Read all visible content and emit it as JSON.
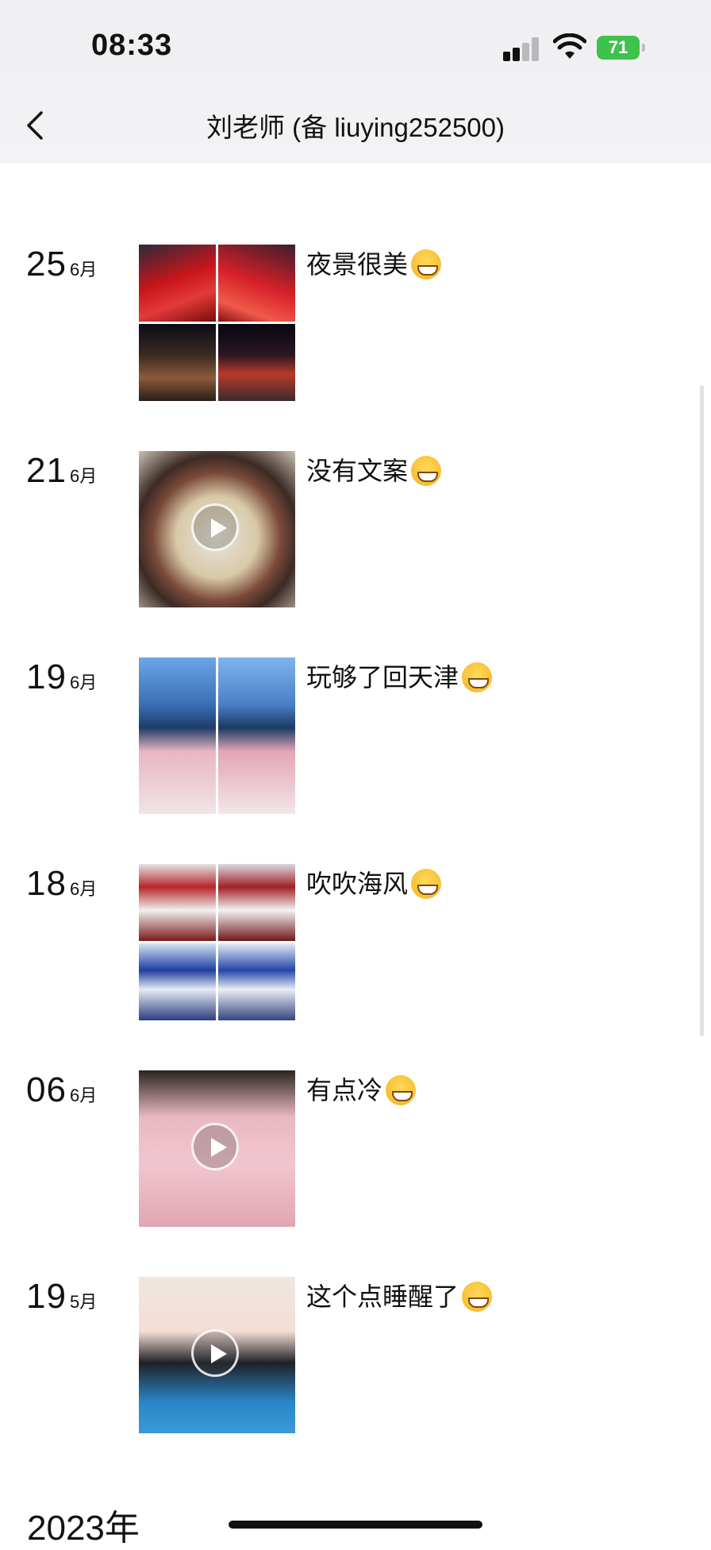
{
  "status_bar": {
    "time": "08:33",
    "battery": "71"
  },
  "nav": {
    "title": "刘老师 (备 liuying252500)"
  },
  "posts": [
    {
      "day": "25",
      "month": "6月",
      "caption": "夜景很美",
      "emoji": "grinning-face",
      "media": "photo-grid-4"
    },
    {
      "day": "21",
      "month": "6月",
      "caption": "没有文案",
      "emoji": "grinning-face",
      "media": "video"
    },
    {
      "day": "19",
      "month": "6月",
      "caption": "玩够了回天津",
      "emoji": "rolling-laughing-face",
      "media": "photo-grid-2"
    },
    {
      "day": "18",
      "month": "6月",
      "caption": "吹吹海风",
      "emoji": "tears-of-joy-face",
      "media": "photo-grid-4"
    },
    {
      "day": "06",
      "month": "6月",
      "caption": "有点冷",
      "emoji": "grinning-face",
      "media": "video"
    },
    {
      "day": "19",
      "month": "5月",
      "caption": "这个点睡醒了",
      "emoji": "rolling-laughing-face",
      "media": "video"
    }
  ],
  "year_header": "2023年"
}
